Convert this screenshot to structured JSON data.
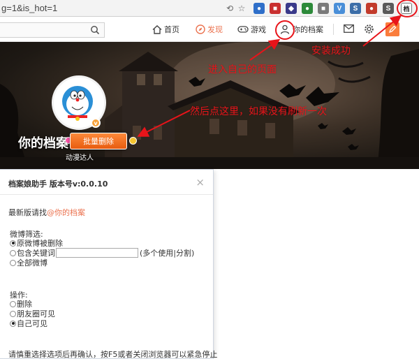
{
  "browser": {
    "url_fragment": "g=1&is_hot=1",
    "extensions": [
      {
        "name": "chrome-ext-1",
        "color": "#2f6fc9",
        "glyph": "●"
      },
      {
        "name": "chrome-ext-2",
        "color": "#c93030",
        "glyph": "■"
      },
      {
        "name": "chrome-ext-3",
        "color": "#3a3a8a",
        "glyph": "◆"
      },
      {
        "name": "chrome-ext-4",
        "color": "#2d8a3a",
        "glyph": "●"
      },
      {
        "name": "chrome-ext-5",
        "color": "#7a7a7a",
        "glyph": "■"
      },
      {
        "name": "chrome-ext-6",
        "color": "#4a8fd8",
        "glyph": "V"
      },
      {
        "name": "chrome-ext-7",
        "color": "#3c6ea8",
        "glyph": "S"
      },
      {
        "name": "chrome-ext-8",
        "color": "#c23b2b",
        "glyph": "●"
      },
      {
        "name": "chrome-ext-9",
        "color": "#5a5a5a",
        "glyph": "S"
      }
    ],
    "dangan_ext_glyph": "档"
  },
  "nav": {
    "home": "首页",
    "find": "发现",
    "game": "游戏",
    "profile": "你的档案"
  },
  "profile": {
    "name": "你的档案",
    "batch_delete": "批量删除",
    "honor": "动漫达人",
    "vip_glyph": "v"
  },
  "annotations": {
    "install": "安装成功",
    "enter": "进入自己的页面",
    "click": "然后点这里，如果没有刷新一次"
  },
  "dialog": {
    "title": "档案娘助手 版本号v:0.0.10",
    "close": "×",
    "latest_prefix": "最新版请找",
    "latest_link": "@你的档案",
    "filter_label": "微博筛选:",
    "filter_options": [
      "原微博被删除",
      "包含关键词",
      "全部微博"
    ],
    "keyword_value": "",
    "keyword_hint": "(多个使用|分割)",
    "op_label": "操作:",
    "op_options": [
      "删除",
      "朋友圈可见",
      "自己可见"
    ],
    "notice": "请慎重选择选项后再确认，按F5或者关闭浏览器可以紧急停止"
  }
}
